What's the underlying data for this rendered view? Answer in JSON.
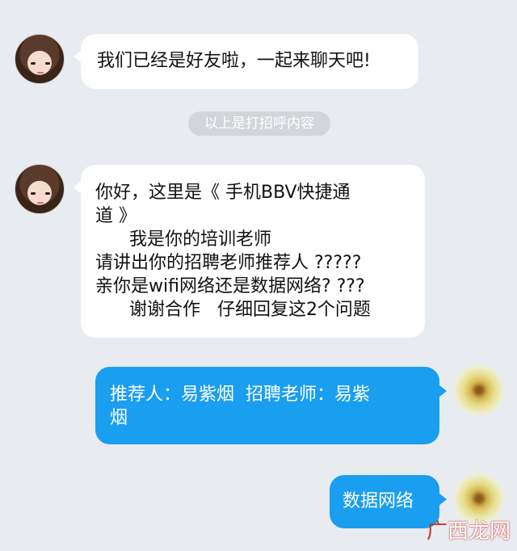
{
  "messages": [
    {
      "id": "m1",
      "side": "left",
      "lines": [
        "我们已经是好友啦，一起来聊天吧!"
      ]
    },
    {
      "id": "m2",
      "side": "left",
      "lines": [
        "你好，这里是《 手机BBV快捷通",
        "道 》",
        "      我是你的培训老师",
        "请讲出你的招聘老师推荐人 ?????",
        "亲你是wifi网络还是数据网络? ???",
        "      谢谢合作   仔细回复这2个问题"
      ]
    },
    {
      "id": "m3",
      "side": "right",
      "lines": [
        "推荐人：易紫烟  招聘老师：易紫",
        "烟"
      ]
    },
    {
      "id": "m4",
      "side": "right",
      "lines": [
        "数据网络"
      ]
    }
  ],
  "system_notice": "以上是打招呼内容",
  "watermark": {
    "prefix": "广",
    "text": "西龙网"
  },
  "colors": {
    "background": "#e8ebf0",
    "outgoing": "#1a9ef0",
    "incoming": "#ffffff"
  }
}
